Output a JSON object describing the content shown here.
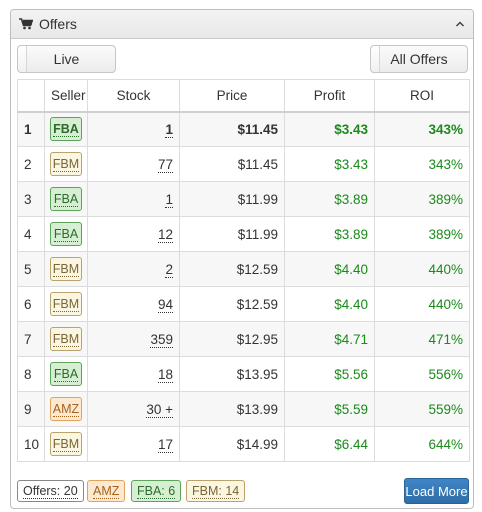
{
  "panel": {
    "title": "Offers"
  },
  "toolbar": {
    "live_label": "Live",
    "all_offers_label": "All Offers"
  },
  "table": {
    "headers": {
      "num": "",
      "seller": "Seller",
      "stock": "Stock",
      "price": "Price",
      "profit": "Profit",
      "roi": "ROI"
    },
    "rows": [
      {
        "num": "1",
        "seller": "FBA",
        "stock": "1",
        "price": "$11.45",
        "profit": "$3.43",
        "roi": "343%"
      },
      {
        "num": "2",
        "seller": "FBM",
        "stock": "77",
        "price": "$11.45",
        "profit": "$3.43",
        "roi": "343%"
      },
      {
        "num": "3",
        "seller": "FBA",
        "stock": "1",
        "price": "$11.99",
        "profit": "$3.89",
        "roi": "389%"
      },
      {
        "num": "4",
        "seller": "FBA",
        "stock": "12",
        "price": "$11.99",
        "profit": "$3.89",
        "roi": "389%"
      },
      {
        "num": "5",
        "seller": "FBM",
        "stock": "2",
        "price": "$12.59",
        "profit": "$4.40",
        "roi": "440%"
      },
      {
        "num": "6",
        "seller": "FBM",
        "stock": "94",
        "price": "$12.59",
        "profit": "$4.40",
        "roi": "440%"
      },
      {
        "num": "7",
        "seller": "FBM",
        "stock": "359",
        "price": "$12.95",
        "profit": "$4.71",
        "roi": "471%"
      },
      {
        "num": "8",
        "seller": "FBA",
        "stock": "18",
        "price": "$13.95",
        "profit": "$5.56",
        "roi": "556%"
      },
      {
        "num": "9",
        "seller": "AMZ",
        "stock": "30 +",
        "price": "$13.99",
        "profit": "$5.59",
        "roi": "559%"
      },
      {
        "num": "10",
        "seller": "FBM",
        "stock": "17",
        "price": "$14.99",
        "profit": "$6.44",
        "roi": "644%"
      }
    ]
  },
  "footer": {
    "offers": "Offers: 20",
    "amz": "AMZ",
    "fba": "FBA: 6",
    "fbm": "FBM: 14",
    "load_more": "Load More"
  },
  "colors": {
    "profit": "#1a8a1a",
    "primary": "#337ab7",
    "fba": "#d6efd2",
    "fbm": "#fbf6e2",
    "amz": "#fde9d2"
  },
  "icons": {
    "header": "cart-icon",
    "collapse": "chevron-up-icon"
  }
}
